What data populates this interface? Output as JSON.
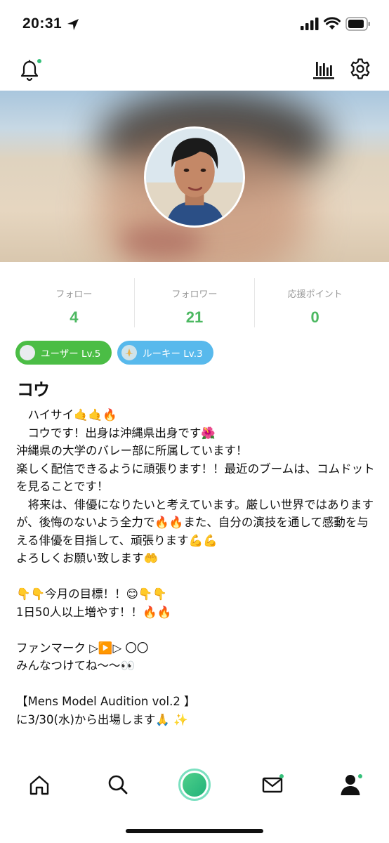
{
  "status_bar": {
    "time": "20:31",
    "icons": [
      "location-arrow-icon",
      "signal-icon",
      "wifi-icon",
      "battery-icon"
    ]
  },
  "top_bar": {
    "icons": [
      "bell-icon",
      "stats-icon",
      "gear-icon"
    ]
  },
  "stats": [
    {
      "label": "フォロー",
      "value": "4"
    },
    {
      "label": "フォロワー",
      "value": "21"
    },
    {
      "label": "応援ポイント",
      "value": "0"
    }
  ],
  "badges": [
    {
      "label": "ユーザー Lv.5",
      "color": "#4bbd45"
    },
    {
      "label": "ルーキー Lv.3",
      "color": "#58b9ec"
    }
  ],
  "profile": {
    "name": "コウ"
  },
  "bio": [
    "　ハイサイ🤙🤙🔥",
    "　コウです！出身は沖縄県出身です🌺",
    "沖縄県の大学のバレー部に所属しています！",
    "楽しく配信できるように頑張ります！！最近のブームは、コムドットを見ることです！",
    "　将来は、俳優になりたいと考えています。厳しい世界ではありますが、後悔のないよう全力で🔥🔥また、自分の演技を通して感動を与える俳優を目指して、頑張ります💪💪",
    "よろしくお願い致します🤲",
    "",
    "👇👇今月の目標！！😊👇👇",
    "1日50人以上増やす！！🔥🔥",
    "",
    "ファンマーク ▷▶️▷ 〇〇",
    "みんなつけてね〜〜👀",
    "",
    "【Mens Model Audition vol.2 】",
    "に3/30(水)から出場します🙏 ✨"
  ],
  "bottom_nav": {
    "items": [
      "home-icon",
      "search-icon",
      "live-button",
      "mail-icon",
      "profile-icon"
    ]
  },
  "colors": {
    "accent_green": "#4cb861",
    "badge_user": "#4bbd45",
    "badge_rookie": "#58b9ec",
    "notification_dot": "#35c07a"
  }
}
